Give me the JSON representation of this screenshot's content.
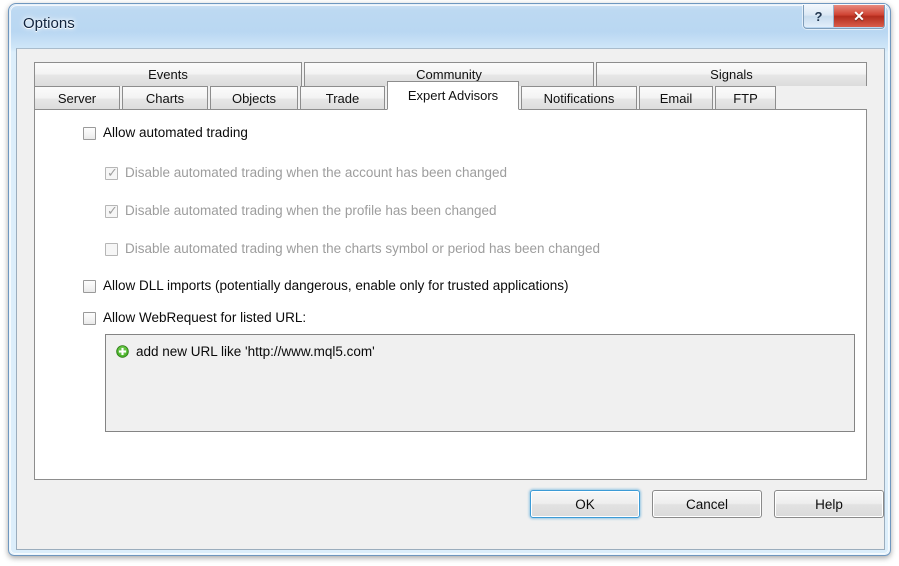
{
  "window": {
    "title": "Options",
    "caption_buttons": [
      {
        "name": "help-button",
        "glyph": "?"
      },
      {
        "name": "close-button",
        "glyph": "✕"
      }
    ]
  },
  "tabs": {
    "top_row": [
      {
        "label": "Events",
        "selected": false
      },
      {
        "label": "Community",
        "selected": false
      },
      {
        "label": "Signals",
        "selected": false
      }
    ],
    "bottom_row": [
      {
        "label": "Server",
        "selected": false
      },
      {
        "label": "Charts",
        "selected": false
      },
      {
        "label": "Objects",
        "selected": false
      },
      {
        "label": "Trade",
        "selected": false
      },
      {
        "label": "Expert Advisors",
        "selected": true
      },
      {
        "label": "Notifications",
        "selected": false
      },
      {
        "label": "Email",
        "selected": false
      },
      {
        "label": "FTP",
        "selected": false
      }
    ]
  },
  "panel": {
    "checkboxes": [
      {
        "label": "Allow automated trading",
        "checked": false,
        "disabled": false,
        "indent": 0
      },
      {
        "label": "Disable automated trading when the account has been changed",
        "checked": true,
        "disabled": true,
        "indent": 1
      },
      {
        "label": "Disable automated trading when the profile has been changed",
        "checked": true,
        "disabled": true,
        "indent": 1
      },
      {
        "label": "Disable automated trading when the charts symbol or period has been changed",
        "checked": false,
        "disabled": true,
        "indent": 1
      },
      {
        "label": "Allow DLL imports (potentially dangerous, enable only for trusted applications)",
        "checked": false,
        "disabled": false,
        "indent": 0
      },
      {
        "label": "Allow WebRequest for listed URL:",
        "checked": false,
        "disabled": false,
        "indent": 0
      }
    ],
    "url_list": {
      "add_icon": "plus-circle-icon",
      "add_text": "add new URL like 'http://www.mql5.com'",
      "entries": []
    }
  },
  "footer": {
    "buttons": [
      {
        "label": "OK",
        "default": true,
        "id": "btn-ok"
      },
      {
        "label": "Cancel",
        "default": false,
        "id": "btn-cancel"
      },
      {
        "label": "Help",
        "default": false,
        "id": "btn-help"
      }
    ]
  },
  "colors": {
    "accent": "#3c9bd6",
    "close_red": "#cf4333",
    "plus_green": "#4ab12a",
    "titlebar_blue": "#bdd9f2",
    "disabled_gray": "#9d9d9d"
  }
}
